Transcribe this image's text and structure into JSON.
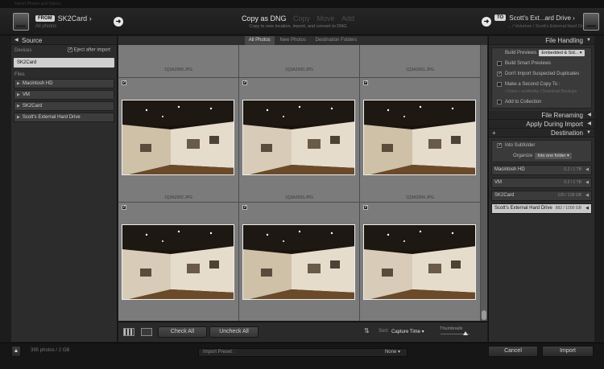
{
  "window": {
    "title": "Import Photos and Videos"
  },
  "header": {
    "source": {
      "badge": "FROM",
      "name": "SK2Card",
      "subtitle": "All photos"
    },
    "modes": [
      "Copy as DNG",
      "Copy",
      "Move",
      "Add"
    ],
    "active_mode": "Copy as DNG",
    "description": "Copy to new location, import, and convert to DNG",
    "destination": {
      "badge": "TO",
      "name": "Scott's Ext...ard Drive",
      "path": "... / Volumes / Scott's External Hard Drive"
    }
  },
  "source_panel": {
    "title": "Source",
    "devices_label": "Devices",
    "eject_label": "Eject after import",
    "eject_checked": true,
    "selected_device": "SK2Card",
    "files_label": "Files",
    "files": [
      "Macintosh HD",
      "VM",
      "SK2Card",
      "Scott's External Hard Drive"
    ]
  },
  "filter_tabs": [
    "All Photos",
    "New Photos",
    "Destination Folders"
  ],
  "grid": {
    "top_row": [
      "1Q3A2989.JPG",
      "1Q3A2990.JPG",
      "1Q3A2991.JPG"
    ],
    "middle_row": [
      "1Q3A2992.JPG",
      "1Q3A2993.JPG",
      "1Q3A2994.JPG"
    ]
  },
  "toolbar": {
    "check_all": "Check All",
    "uncheck_all": "Uncheck All",
    "sort_label": "Sort:",
    "sort_value": "Capture Time",
    "thumbnails_label": "Thumbnails",
    "thumbnail_size": 0.85
  },
  "right_panel": {
    "file_handling": {
      "title": "File Handling",
      "build_previews_label": "Build Previews",
      "build_previews_value": "Embedded & Sid...",
      "smart_previews": "Build Smart Previews",
      "dont_import_dupes": "Don't Import Suspected Duplicates",
      "second_copy": "Make a Second Copy To :",
      "second_copy_path": "/ Users / scottkelby / Download Backups",
      "add_collection": "Add to Collection"
    },
    "file_renaming": "File Renaming",
    "apply_during_import": "Apply During Import",
    "destination": {
      "title": "Destination",
      "into_subfolder": "Into Subfolder",
      "organize_label": "Organize",
      "organize_value": "Into one folder",
      "volumes": [
        {
          "name": "Macintosh HD",
          "capacity": "0.2 / 1 TB"
        },
        {
          "name": "VM",
          "capacity": "0.2 / 1 TB"
        },
        {
          "name": "SK2Card",
          "capacity": "125 / 128 GB"
        },
        {
          "name": "Scott's External Hard Drive",
          "capacity": "882 / 1000 GB"
        }
      ]
    }
  },
  "footer": {
    "count": "395 photos / 2 GB",
    "preset_label": "Import Preset :",
    "preset_value": "None",
    "cancel": "Cancel",
    "import": "Import"
  }
}
